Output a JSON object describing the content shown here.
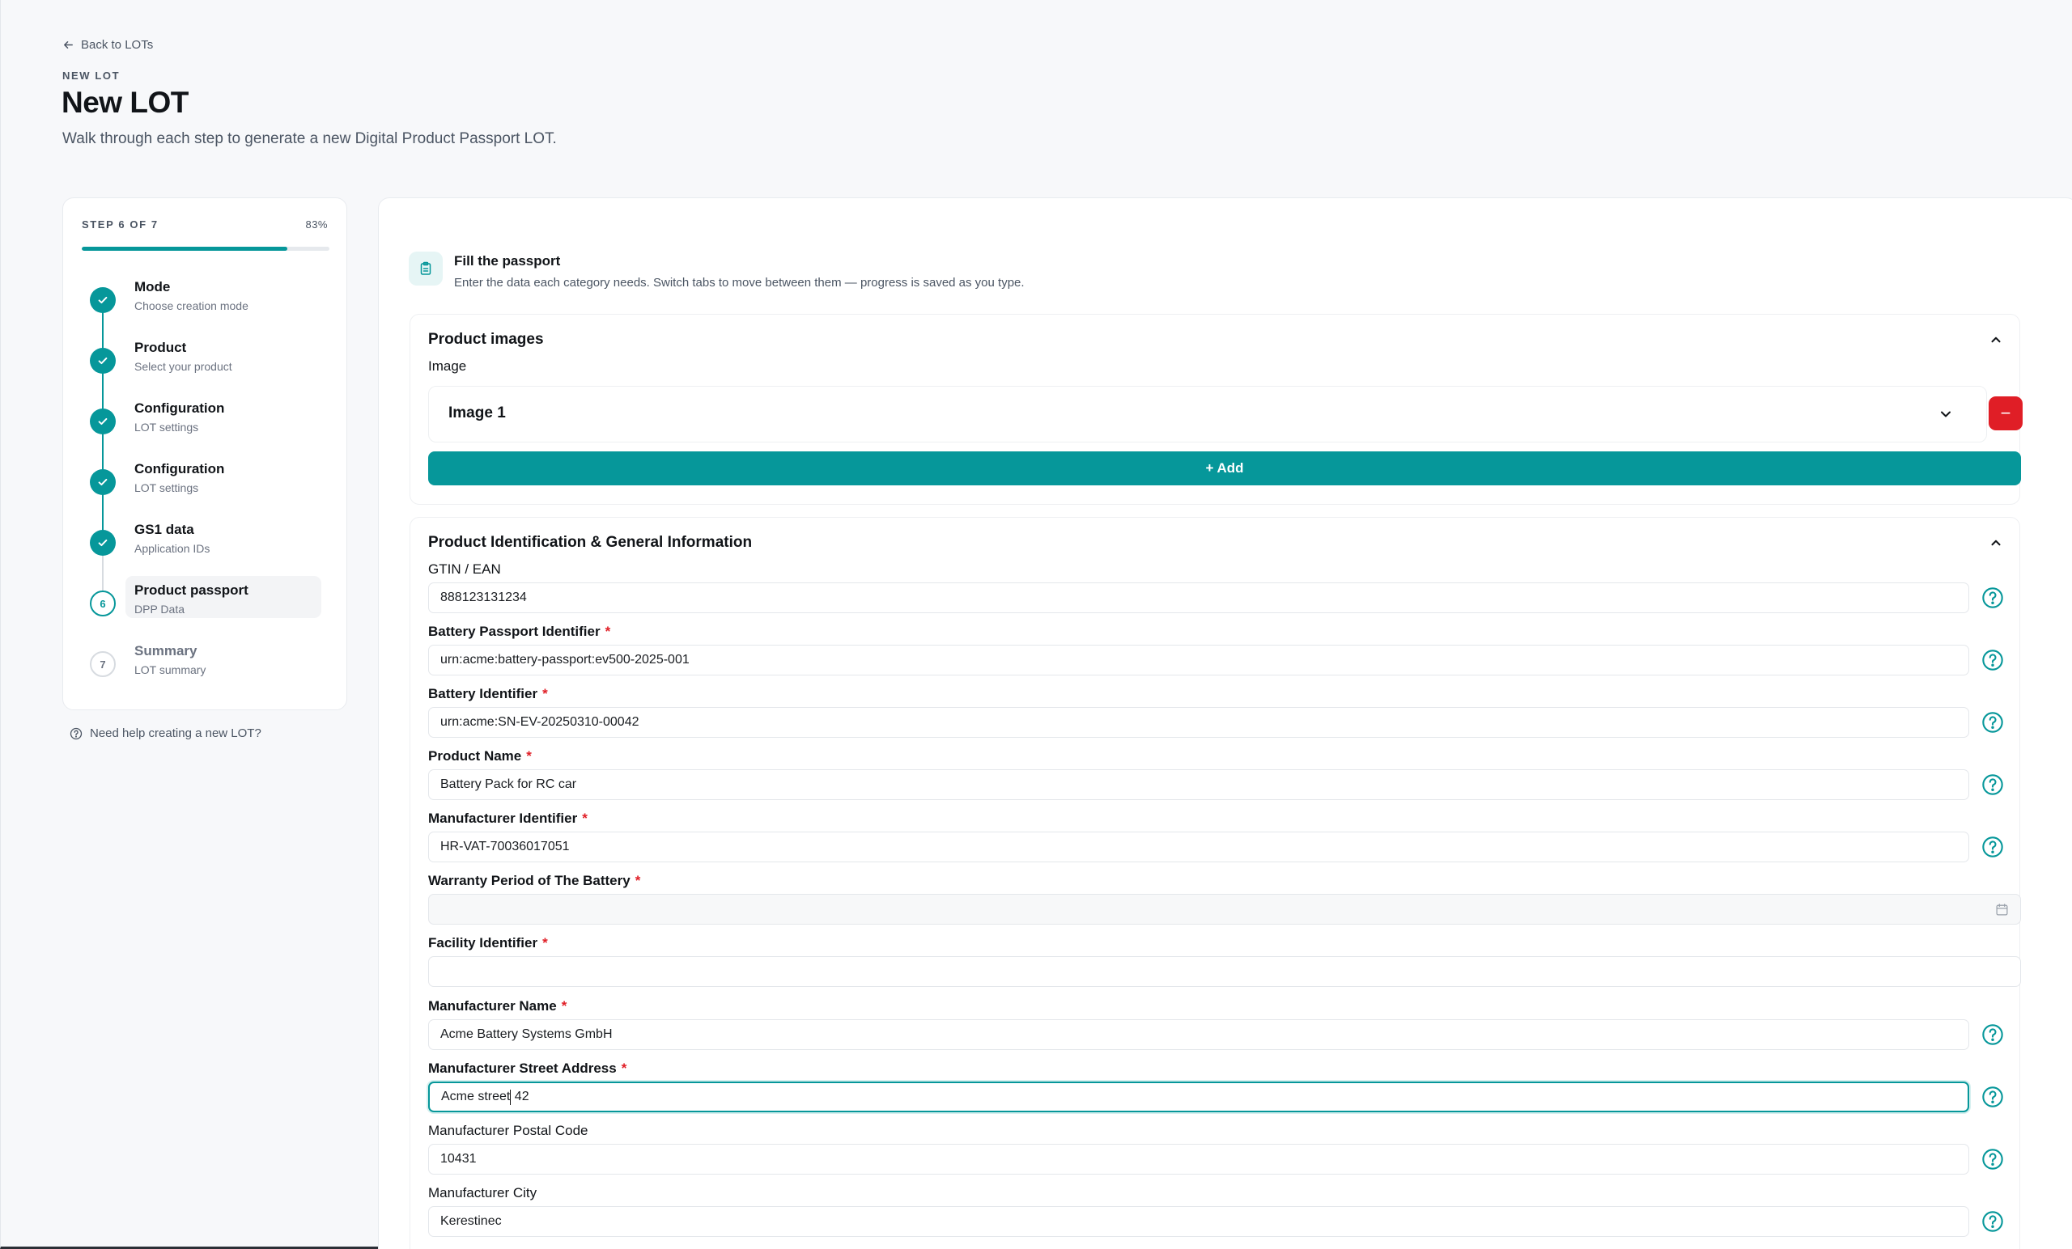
{
  "header": {
    "back_label": "Back to LOTs",
    "eyebrow": "NEW LOT",
    "title": "New LOT",
    "subtitle": "Walk through each step to generate a new Digital Product Passport LOT."
  },
  "stepper": {
    "step_label": "STEP 6 OF 7",
    "percent_label": "83%",
    "progress": 0.83,
    "steps": [
      {
        "title": "Mode",
        "sub": "Choose creation mode",
        "state": "done"
      },
      {
        "title": "Product",
        "sub": "Select your product",
        "state": "done"
      },
      {
        "title": "Configuration",
        "sub": "LOT settings",
        "state": "done"
      },
      {
        "title": "Configuration",
        "sub": "LOT settings",
        "state": "done"
      },
      {
        "title": "GS1 data",
        "sub": "Application IDs",
        "state": "done"
      },
      {
        "title": "Product passport",
        "sub": "DPP Data",
        "state": "current",
        "number": "6"
      },
      {
        "title": "Summary",
        "sub": "LOT summary",
        "state": "todo",
        "number": "7"
      }
    ],
    "help_label": "Need help creating a new LOT?"
  },
  "passport": {
    "title": "Fill the passport",
    "subtitle": "Enter the data each category needs. Switch tabs to move between them — progress is saved as you type."
  },
  "images_section": {
    "title": "Product images",
    "image_label": "Image",
    "item_label": "Image 1",
    "remove_label": "−",
    "add_label": "+ Add"
  },
  "ident_section": {
    "title": "Product Identification & General Information",
    "fields": [
      {
        "label": "GTIN / EAN",
        "value": "888123131234",
        "required": false,
        "help": true
      },
      {
        "label": "Battery Passport Identifier",
        "value": "urn:acme:battery-passport:ev500-2025-001",
        "required": true,
        "help": true
      },
      {
        "label": "Battery Identifier",
        "value": "urn:acme:SN-EV-20250310-00042",
        "required": true,
        "help": true
      },
      {
        "label": "Product Name",
        "value": "Battery Pack for RC car",
        "required": true,
        "help": true
      },
      {
        "label": "Manufacturer Identifier",
        "value": "HR-VAT-70036017051",
        "required": true,
        "help": true
      },
      {
        "label": "Warranty Period of The Battery",
        "value": "",
        "required": true,
        "help": false
      },
      {
        "label": "Facility Identifier",
        "value": "",
        "required": true,
        "help": false
      },
      {
        "label": "Manufacturer Name",
        "value": "Acme Battery Systems GmbH",
        "required": true,
        "help": true
      },
      {
        "label": "Manufacturer Street Address",
        "value_before_caret": "Acme street",
        "value_after_caret": " 42",
        "required": true,
        "help": true
      },
      {
        "label": "Manufacturer Postal Code",
        "value": "10431",
        "required": false,
        "help": true
      },
      {
        "label": "Manufacturer City",
        "value": "Kerestinec",
        "required": false,
        "help": true
      }
    ],
    "required_mark": "*"
  },
  "colors": {
    "accent": "#06979a",
    "danger": "#e01e26",
    "text": "#111418",
    "muted": "#4b5563"
  }
}
